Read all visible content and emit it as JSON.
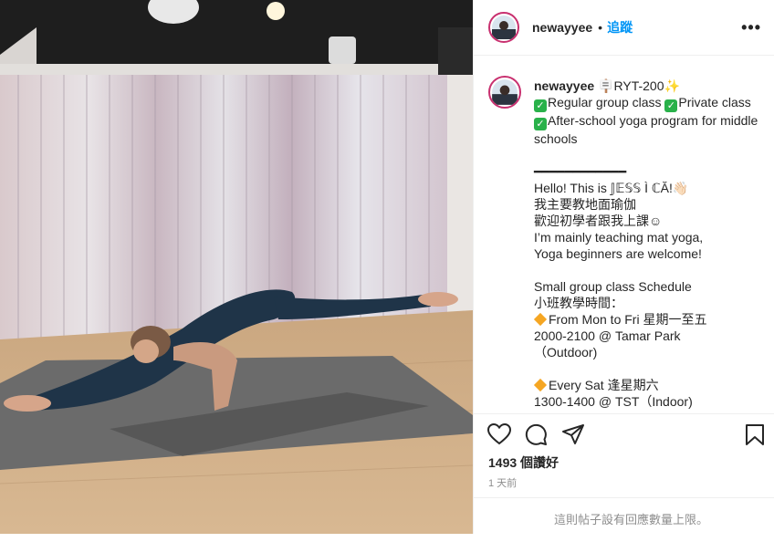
{
  "post": {
    "username": "newayyee",
    "follow_label": "追蹤",
    "dot": "•",
    "more_label": "•••",
    "caption": {
      "username": "newayyee",
      "line1_rest": " 🪧RYT-200✨",
      "line2a": "Regular group class ",
      "line2b": "Private class",
      "line3": "After-school yoga program for middle schools",
      "divider": "━━━━━━━━━━━━",
      "hello": "Hello! This is 𝕁𝔼𝕊𝕊 Ì ℂĂ!👋🏻",
      "zh1": "我主要教地面瑜伽",
      "zh2": "歡迎初學者跟我上課☺︎",
      "en1": "I’m mainly teaching mat yoga,",
      "en2": "Yoga beginners are welcome!",
      "sched1": "Small group class Schedule",
      "sched2": "小班教學時間：",
      "mon": "From Mon to Fri 星期一至五",
      "mon_time": "2000-2100 @ Tamar Park",
      "mon_loc": "（Outdoor)",
      "sat": "Every Sat 逢星期六",
      "sat_time": "1300-1400 @ TST（Indoor)"
    },
    "likes_label": "1493 個讚好",
    "timestamp": "1 天前",
    "comments_disabled": "這則帖子設有回應數量上限。"
  },
  "icons": {
    "like": "heart-icon",
    "comment": "comment-icon",
    "share": "share-icon",
    "save": "bookmark-icon",
    "check": "check-box-icon",
    "diamond": "orange-diamond-icon"
  },
  "colors": {
    "follow": "#0095f6",
    "check": "#29b14a",
    "diamond": "#f5a623",
    "muted": "#8e8e8e"
  }
}
